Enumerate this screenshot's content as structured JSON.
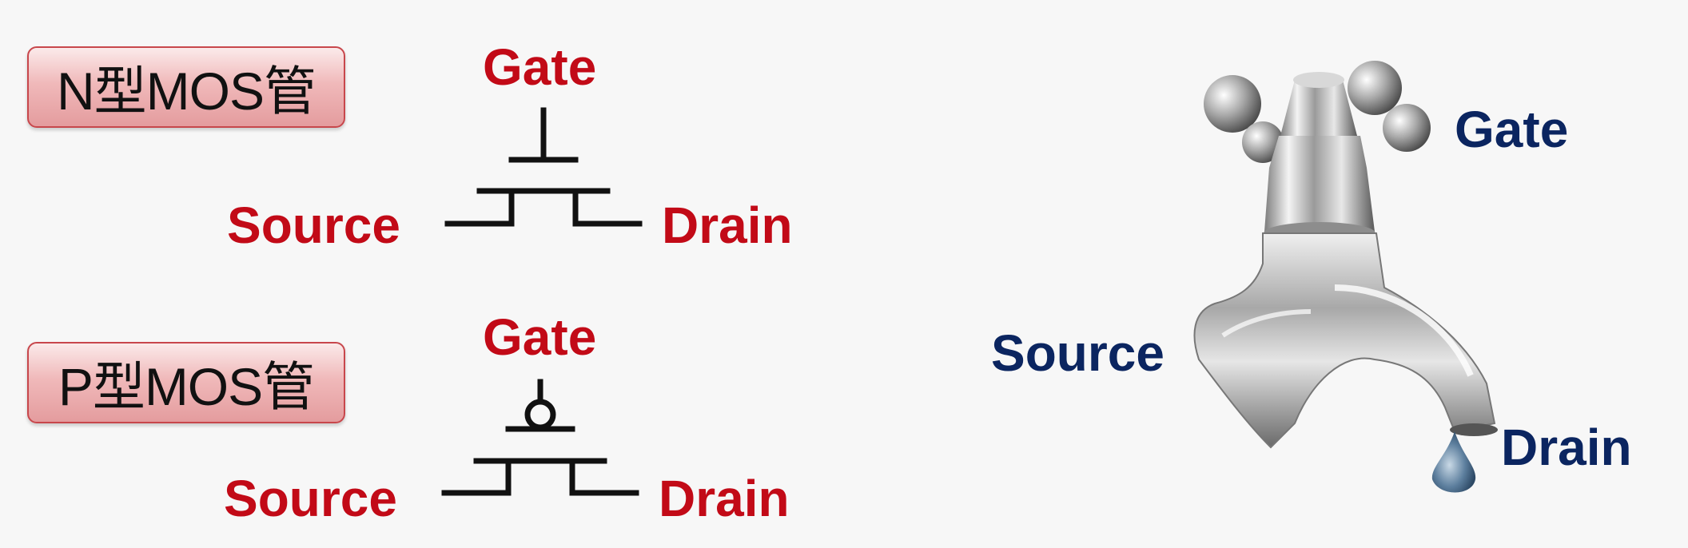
{
  "nmos": {
    "title": "N型MOS管",
    "gate": "Gate",
    "source": "Source",
    "drain": "Drain"
  },
  "pmos": {
    "title": "P型MOS管",
    "gate": "Gate",
    "source": "Source",
    "drain": "Drain"
  },
  "faucet": {
    "gate": "Gate",
    "source": "Source",
    "drain": "Drain"
  },
  "colors": {
    "label_red": "#c20a17",
    "label_navy": "#0b2560",
    "badge_border": "#c8474c"
  }
}
